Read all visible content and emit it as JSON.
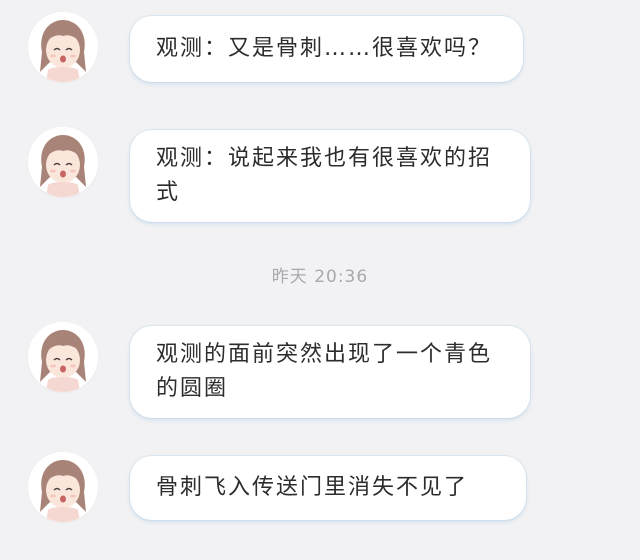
{
  "messages": [
    {
      "text": "观测：又是骨刺……很喜欢吗？"
    },
    {
      "text": "观测：说起来我也有很喜欢的招式"
    },
    {
      "text": "观测的面前突然出现了一个青色的圆圈"
    },
    {
      "text": "骨刺飞入传送门里消失不见了"
    }
  ],
  "timestamp": "昨天 20:36",
  "avatar": {
    "icon": "girl-avatar-icon"
  },
  "colors": {
    "background": "#f2f2f4",
    "bubble": "#ffffff",
    "text": "#2c2c2c",
    "timestamp": "#a9a9ad",
    "bubble_shadow": "#96bedc"
  }
}
